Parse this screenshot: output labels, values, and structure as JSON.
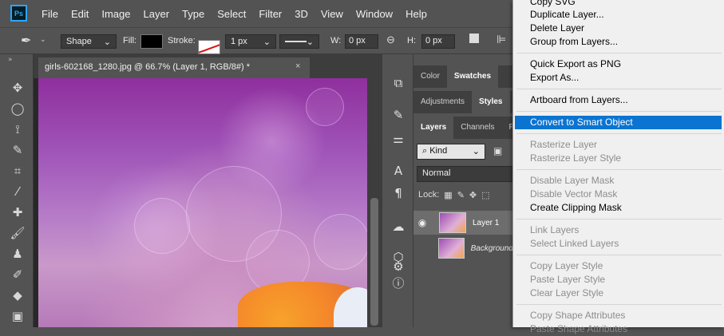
{
  "app": {
    "logo_text": "Ps",
    "menus": [
      "File",
      "Edit",
      "Image",
      "Layer",
      "Type",
      "Select",
      "Filter",
      "3D",
      "View",
      "Window",
      "Help"
    ]
  },
  "options_bar": {
    "tool_icon": "pen-icon",
    "mode": "Shape",
    "fill_label": "Fill:",
    "stroke_label": "Stroke:",
    "stroke_width": "1 px",
    "w_label": "W:",
    "w_value": "0 px",
    "h_label": "H:",
    "h_value": "0 px",
    "fill_color": "#000000",
    "stroke_color": "#d11111"
  },
  "document": {
    "tab_title": "girls-602168_1280.jpg @ 66.7% (Layer 1, RGB/8#) *",
    "close_glyph": "×"
  },
  "tools": [
    "move-icon",
    "ellipse-marquee-icon",
    "lasso-icon",
    "quick-select-icon",
    "crop-icon",
    "eyedropper-icon",
    "healing-brush-icon",
    "brush-icon",
    "stamp-icon",
    "history-brush-icon",
    "eraser-icon",
    "gradient-icon"
  ],
  "panel_icons": [
    "history-icon",
    "brush-settings-icon",
    "adjust-sliders-icon",
    "character-icon",
    "paragraph-icon",
    "creative-cloud-icon",
    "3d-icon",
    "properties-icon",
    "info-icon"
  ],
  "panels": {
    "row1": [
      "Color",
      "Swatches"
    ],
    "row1_active": "Swatches",
    "row2": [
      "Adjustments",
      "Styles"
    ],
    "row2_active": "Styles",
    "row3": [
      "Layers",
      "Channels",
      "P"
    ],
    "row3_active": "Layers",
    "kind_filter": "Kind",
    "blend_mode": "Normal",
    "lock_label": "Lock:",
    "layers": [
      {
        "name": "Layer 1",
        "visible": true,
        "selected": true
      },
      {
        "name": "Background",
        "visible": false,
        "selected": false
      }
    ]
  },
  "context_menu": {
    "items": [
      {
        "label": "Copy SVG",
        "state": "enabled"
      },
      {
        "label": "Duplicate Layer...",
        "state": "enabled"
      },
      {
        "label": "Delete Layer",
        "state": "enabled"
      },
      {
        "label": "Group from Layers...",
        "state": "enabled"
      },
      {
        "label": "Quick Export as PNG",
        "state": "enabled"
      },
      {
        "label": "Export As...",
        "state": "enabled"
      },
      {
        "label": "Artboard from Layers...",
        "state": "enabled"
      },
      {
        "label": "Convert to Smart Object",
        "state": "highlight"
      },
      {
        "label": "Rasterize Layer",
        "state": "disabled"
      },
      {
        "label": "Rasterize Layer Style",
        "state": "disabled"
      },
      {
        "label": "Disable Layer Mask",
        "state": "disabled"
      },
      {
        "label": "Disable Vector Mask",
        "state": "disabled"
      },
      {
        "label": "Create Clipping Mask",
        "state": "enabled"
      },
      {
        "label": "Link Layers",
        "state": "disabled"
      },
      {
        "label": "Select Linked Layers",
        "state": "disabled"
      },
      {
        "label": "Copy Layer Style",
        "state": "disabled"
      },
      {
        "label": "Paste Layer Style",
        "state": "disabled"
      },
      {
        "label": "Clear Layer Style",
        "state": "disabled"
      },
      {
        "label": "Copy Shape Attributes",
        "state": "disabled"
      },
      {
        "label": "Paste Shape Attributes",
        "state": "disabled"
      }
    ],
    "highlight_color": "#0b74d1"
  }
}
